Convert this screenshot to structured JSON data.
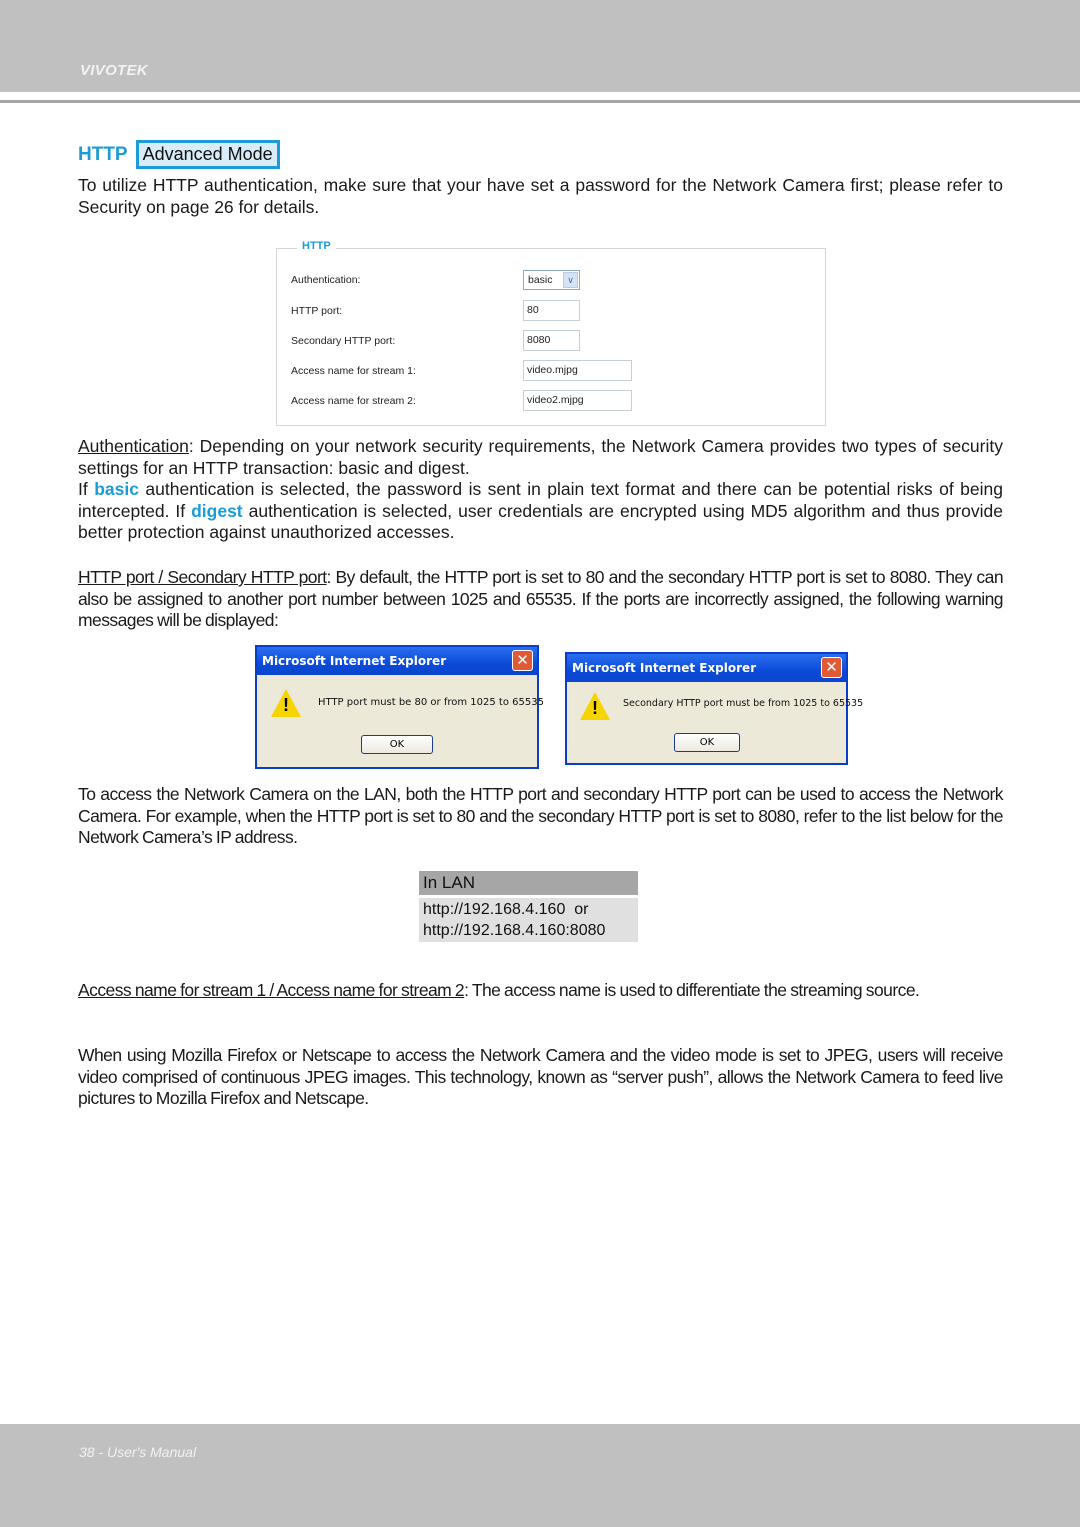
{
  "header": {
    "brand": "VIVOTEK"
  },
  "section": {
    "title": "HTTP",
    "mode_badge": "Advanced Mode"
  },
  "intro": "To utilize HTTP authentication, make sure that your have set a password for the Network Camera first; please refer to Security on page 26 for details.",
  "settings_panel": {
    "legend": "HTTP",
    "fields": [
      {
        "label": "Authentication:",
        "type": "select",
        "value": "basic"
      },
      {
        "label": "HTTP port:",
        "type": "text",
        "value": "80"
      },
      {
        "label": "Secondary HTTP port:",
        "type": "text",
        "value": "8080"
      },
      {
        "label": "Access name for stream 1:",
        "type": "text",
        "value": "video.mjpg"
      },
      {
        "label": "Access name for stream 2:",
        "type": "text",
        "value": "video2.mjpg"
      }
    ]
  },
  "auth_para": {
    "term": "Authentication",
    "text1": ": Depending on your network security requirements, the Network Camera provides two types of security settings for an HTTP transaction: basic and digest.",
    "if1": "If ",
    "kw_basic": "basic",
    "text2": " authentication is selected, the password is sent in plain text format and there can be potential risks of being intercepted. If ",
    "kw_digest": "digest",
    "text3": " authentication is selected, user credentials are encrypted using MD5 algorithm and thus provide better protection against unauthorized accesses."
  },
  "port_para": {
    "term": "HTTP port / Secondary HTTP port",
    "text": ": By default, the HTTP port is set to 80 and the secondary HTTP port is set to 8080. They can also be assigned to another port number between 1025 and 65535. If the ports are incorrectly assigned, the following warning messages will be displayed:"
  },
  "dialogs": [
    {
      "title": "Microsoft Internet Explorer",
      "message": "HTTP port must be 80 or from 1025 to 65535",
      "ok": "OK",
      "close": "✕",
      "icon": "!"
    },
    {
      "title": "Microsoft Internet Explorer",
      "message": "Secondary HTTP port must be from 1025 to 65535",
      "ok": "OK",
      "close": "✕",
      "icon": "!"
    }
  ],
  "lan_para": "To access the Network Camera on the LAN, both the HTTP port and secondary HTTP port can be used to access the Network Camera. For example, when the HTTP port is set to 80 and the secondary HTTP port is set to 8080, refer to the list below for the Network Camera’s IP address.",
  "lan_table": {
    "header": "In LAN",
    "body": "http://192.168.4.160  or\nhttp://192.168.4.160:8080"
  },
  "access_para": {
    "term": "Access name for stream 1 / Access name for stream 2",
    "text": ": The access name is used to differentiate the streaming source."
  },
  "push_para": "When using Mozilla Firefox or Netscape to access the Network Camera and the video mode is set to JPEG, users will receive video comprised of continuous JPEG images. This technology, known as “server push”, allows the Network Camera to feed live pictures to Mozilla Firefox and Netscape.",
  "footer": {
    "text": "38 - User's Manual"
  }
}
